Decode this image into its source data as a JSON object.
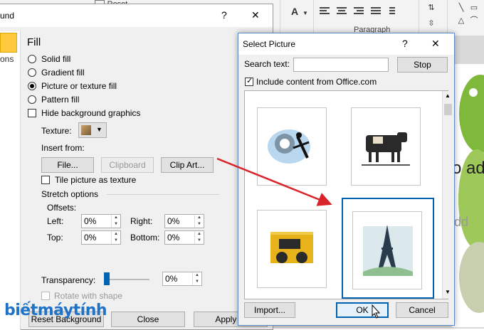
{
  "ribbon": {
    "reset_label": "Reset",
    "paragraph_group_label": "Paragraph"
  },
  "format_dialog": {
    "title_fragment": "und",
    "help_label": "?",
    "close_glyph": "✕",
    "sidebar_label_fragment": "ons",
    "section_title": "Fill",
    "options": {
      "solid_fill": "Solid fill",
      "gradient_fill": "Gradient fill",
      "picture_texture_fill": "Picture or texture fill",
      "pattern_fill": "Pattern fill"
    },
    "selected_option": "picture_texture_fill",
    "hide_background_label": "Hide background graphics",
    "texture_label": "Texture:",
    "insert_from_label": "Insert from:",
    "file_button": "File...",
    "clipboard_button": "Clipboard",
    "clip_art_button": "Clip Art...",
    "tile_label": "Tile picture as texture",
    "stretch_options_label": "Stretch options",
    "offsets_label": "Offsets:",
    "offsets": {
      "left_label": "Left:",
      "left_value": "0%",
      "right_label": "Right:",
      "right_value": "0%",
      "top_label": "Top:",
      "top_value": "0%",
      "bottom_label": "Bottom:",
      "bottom_value": "0%"
    },
    "transparency_label": "Transparency:",
    "transparency_value": "0%",
    "transparency_level": 0,
    "rotate_label": "Rotate with shape",
    "reset_background_button": "Reset Background",
    "close_button": "Close",
    "apply_button": "Apply to"
  },
  "select_picture": {
    "title": "Select Picture",
    "help_label": "?",
    "close_glyph": "✕",
    "search_label": "Search text:",
    "search_value": "",
    "stop_button": "Stop",
    "include_office_label": "Include content from Office.com",
    "include_office_checked": true,
    "images": [
      {
        "name": "figure-clipart",
        "selected": false
      },
      {
        "name": "cow-clipart",
        "selected": false
      },
      {
        "name": "tractor-clipart",
        "selected": false
      },
      {
        "name": "eiffel-tower-clipart",
        "selected": true
      }
    ],
    "import_button": "Import...",
    "ok_button": "OK",
    "cancel_button": "Cancel"
  },
  "slide": {
    "text_fragment": "o ad",
    "text_fragment2": "dd"
  },
  "watermark": "biếtmáytính",
  "colors": {
    "accent_blue": "#0063b1",
    "arrow_red": "#d9232a",
    "brand_blue": "#1e73c8",
    "selection_yellow": "#ffc83d"
  }
}
